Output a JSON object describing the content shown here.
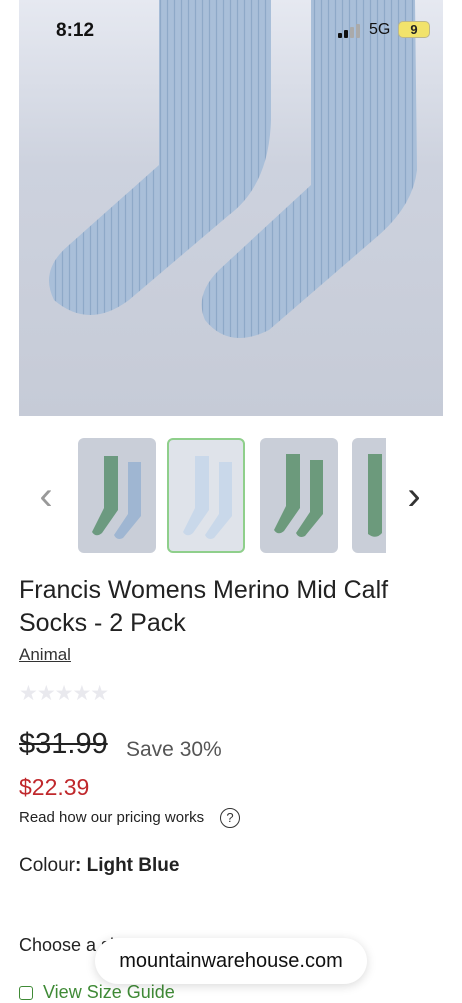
{
  "status_bar": {
    "time": "8:12",
    "network": "5G",
    "battery": "9"
  },
  "product": {
    "title": "Francis Womens Merino Mid Calf Socks - 2 Pack",
    "brand": "Animal",
    "rating_stars": "★★★★★",
    "original_price": "$31.99",
    "save_text": "Save 30%",
    "price": "$22.39",
    "pricing_link": "Read how our pricing works",
    "help_icon": "?",
    "colour_label": "Colour",
    "colour_value": ": Light Blue",
    "choose_size": "Choose a size",
    "size_guide": "View Size Guide"
  },
  "gallery": {
    "prev_arrow": "‹",
    "next_arrow": "›",
    "thumbnails": [
      {
        "name": "green-and-blue",
        "selected": false
      },
      {
        "name": "light-blue",
        "selected": true
      },
      {
        "name": "green",
        "selected": false
      },
      {
        "name": "green-side",
        "selected": false
      }
    ]
  },
  "browser": {
    "url": "mountainwarehouse.com"
  },
  "colors": {
    "accent_green": "#3f8a36",
    "sale_red": "#c0282c",
    "selected_border": "#8fcf8b"
  }
}
